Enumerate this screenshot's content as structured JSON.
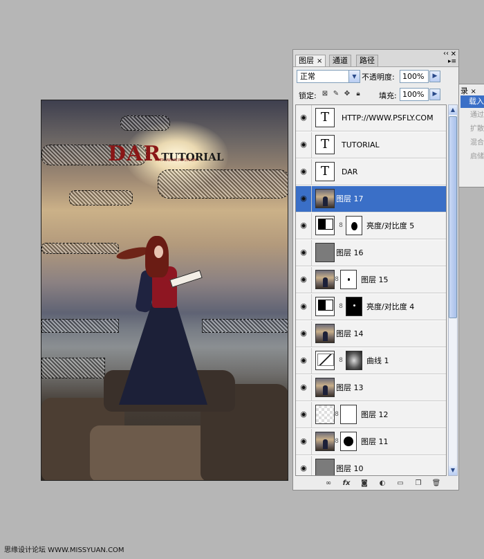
{
  "canvas": {
    "logo_main": "DAR",
    "logo_sub": "TUTORIAL",
    "logo_url": "HTTP://WWW.PSFLY.COM"
  },
  "layers_panel": {
    "tabs": [
      {
        "label": "图层",
        "close": "×"
      },
      {
        "label": "通道"
      },
      {
        "label": "路径"
      }
    ],
    "blend_mode": "正常",
    "opacity_label": "不透明度:",
    "opacity_value": "100%",
    "lock_label": "锁定:",
    "fill_label": "填充:",
    "fill_value": "100%",
    "layers": [
      {
        "name": "HTTP://WWW.PSFLY.COM",
        "thumb": "text",
        "thumb_glyph": "T"
      },
      {
        "name": "TUTORIAL",
        "thumb": "text",
        "thumb_glyph": "T"
      },
      {
        "name": "DAR",
        "thumb": "text",
        "thumb_glyph": "T"
      },
      {
        "name": "图层 17",
        "thumb": "photo",
        "selected": true
      },
      {
        "name": "亮度/对比度 5",
        "thumb": "adjustment",
        "mask": "white-blob"
      },
      {
        "name": "图层 16",
        "thumb": "gray"
      },
      {
        "name": "图层 15",
        "thumb": "photo",
        "mask": "white-speck"
      },
      {
        "name": "亮度/对比度 4",
        "thumb": "adjustment",
        "mask": "black-speck"
      },
      {
        "name": "图层 14",
        "thumb": "photo"
      },
      {
        "name": "曲线 1",
        "thumb": "curves",
        "mask": "photo"
      },
      {
        "name": "图层 13",
        "thumb": "photo"
      },
      {
        "name": "图层 12",
        "thumb": "transparent",
        "mask": "white"
      },
      {
        "name": "图层 11",
        "thumb": "photo",
        "mask": "white-blob"
      },
      {
        "name": "图层 10",
        "thumb": "gray"
      }
    ],
    "icons": {
      "visibility": "eye-icon",
      "link": "chain-link-icon"
    }
  },
  "history_panel": {
    "tab_label": "录",
    "tab_close": "×",
    "selected_item": "载入",
    "items": [
      "通过",
      "扩散",
      "混合",
      "启储"
    ]
  },
  "watermark": "思缘设计论坛 WWW.MISSYUAN.COM",
  "colors": {
    "selection_blue": "#3a6fc7",
    "panel_bg": "#ececec",
    "desktop_bg": "#b6b6b6",
    "logo_red": "#8a1616"
  }
}
